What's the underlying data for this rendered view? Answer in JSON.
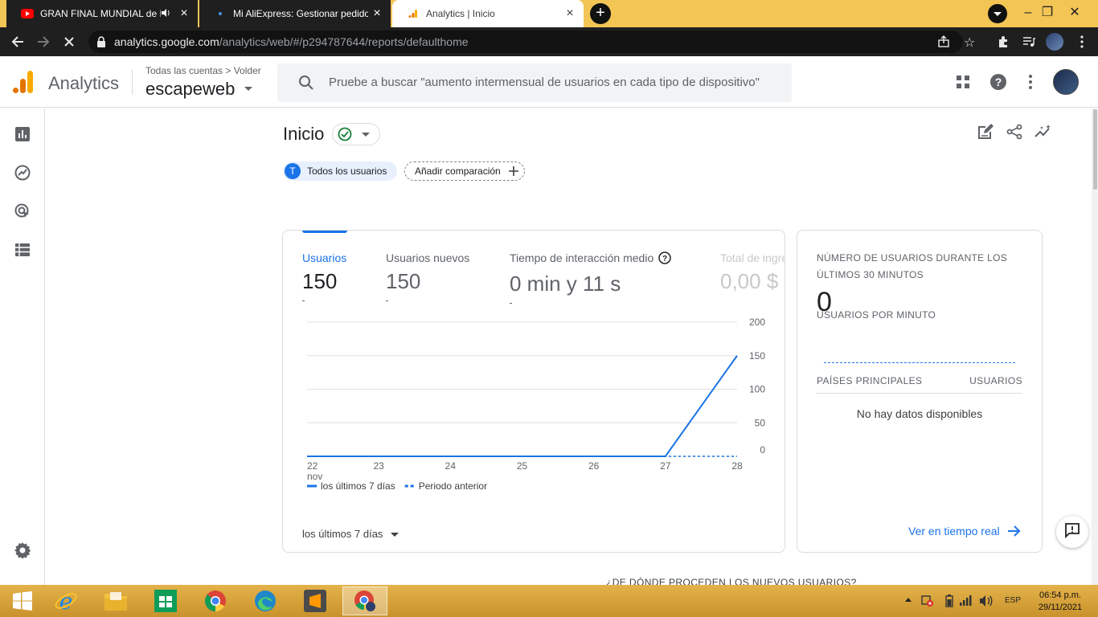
{
  "browser": {
    "tabs": [
      {
        "title": "GRAN FINAL MUNDIAL de B",
        "favicon": "youtube-icon",
        "muted_icon": "speaker-icon"
      },
      {
        "title": "Mi AliExpress: Gestionar pedidos",
        "favicon": "aliexpress-icon"
      },
      {
        "title": "Analytics | Inicio",
        "favicon": "analytics-icon",
        "active": true
      }
    ],
    "url_host": "analytics.google.com",
    "url_path": "/analytics/web/#/p294787644/reports/defaulthome"
  },
  "header": {
    "product": "Analytics",
    "breadcrumb": "Todas las cuentas > Volder",
    "property": "escapeweb",
    "search_placeholder": "Pruebe a buscar \"aumento intermensual de usuarios en cada tipo de dispositivo\""
  },
  "page": {
    "title": "Inicio",
    "segment_initial": "T",
    "segment_label": "Todos los usuarios",
    "compare_label": "Añadir comparación"
  },
  "metrics": [
    {
      "label": "Usuarios",
      "value": "150",
      "selected": true
    },
    {
      "label": "Usuarios nuevos",
      "value": "150"
    },
    {
      "label": "Tiempo de interacción medio",
      "value": "0 min y 11 s"
    },
    {
      "label": "Total de ingresos",
      "value": "0,00 $"
    }
  ],
  "chart_data": {
    "type": "line",
    "x": [
      "22 nov",
      "23",
      "24",
      "25",
      "26",
      "27",
      "28"
    ],
    "series": [
      {
        "name": "los últimos 7 días",
        "values": [
          0,
          0,
          0,
          0,
          0,
          0,
          150
        ],
        "style": "solid",
        "color": "#1a73e8"
      },
      {
        "name": "Periodo anterior",
        "values": [
          0,
          0,
          0,
          0,
          0,
          0,
          0
        ],
        "style": "dashed",
        "color": "#1a73e8"
      }
    ],
    "y_ticks": [
      0,
      50,
      100,
      150,
      200
    ],
    "ylim": [
      0,
      200
    ],
    "grid": true,
    "legend_position": "bottom"
  },
  "range_selector": "los últimos 7 días",
  "realtime": {
    "title": "NÚMERO DE USUARIOS DURANTE LOS ÚLTIMOS 30 MINUTOS",
    "value": "0",
    "subtitle": "USUARIOS POR MINUTO",
    "col_country": "PAÍSES PRINCIPALES",
    "col_users": "USUARIOS",
    "empty": "No hay datos disponibles",
    "link": "Ver en tiempo real"
  },
  "below_section_title": "¿DE DÓNDE PROCEDEN LOS NUEVOS USUARIOS?",
  "taskbar": {
    "lang": "ESP",
    "time": "06:54 p.m.",
    "date": "29/11/2021"
  },
  "colors": {
    "accent": "#1a73e8",
    "chrome_frame": "#f2c555",
    "taskbar": "#d9a43c"
  }
}
